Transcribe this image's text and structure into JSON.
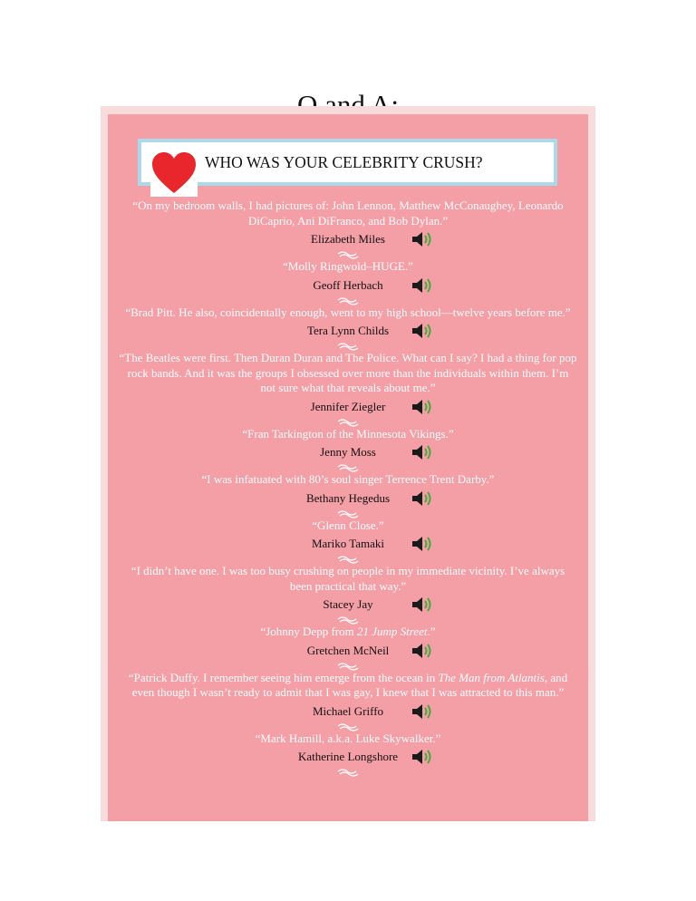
{
  "page_title": "Q and A:",
  "question": "WHO WAS YOUR CELEBRITY CRUSH?",
  "colors": {
    "panel": "#f49ea6",
    "frame": "#a9d9ea",
    "heart": "#e8262c",
    "speaker_green": "#3fae3a"
  },
  "icons": {
    "heart": "heart-icon",
    "speaker": "speaker-icon",
    "divider": "ornament-icon"
  },
  "entries": [
    {
      "quote": "“On my bedroom walls, I had pictures of: John Lennon, Matthew McConaughey, Leonardo DiCaprio, Ani DiFranco, and Bob Dylan.”",
      "author": "Elizabeth Miles"
    },
    {
      "quote": "“Molly Ringwold–HUGE.”",
      "author": "Geoff Herbach"
    },
    {
      "quote": "“Brad Pitt. He also, coincidentally enough, went to my high school—twelve years before me.”",
      "author": "Tera Lynn Childs"
    },
    {
      "quote": "“The Beatles were first. Then Duran Duran and The Police. What can I say? I had a thing for pop rock bands. And it was the groups I obsessed over more than the individuals within them. I’m not sure what that reveals about me.”",
      "author": "Jennifer Ziegler"
    },
    {
      "quote": "“Fran Tarkington of the Minnesota Vikings.”",
      "author": "Jenny Moss"
    },
    {
      "quote": "“I was infatuated with 80’s soul singer Terrence Trent Darby.”",
      "author": "Bethany Hegedus"
    },
    {
      "quote": "“Glenn Close.”",
      "author": "Mariko Tamaki"
    },
    {
      "quote": "“I didn’t have one. I was too busy crushing on people in my immediate vicinity. I’ve always been practical that way.”",
      "author": "Stacey Jay"
    },
    {
      "quote_pre": "“Johnny Depp from ",
      "quote_italic": "21 Jump Street",
      "quote_post": ".”",
      "author": "Gretchen McNeil"
    },
    {
      "quote_pre": "“Patrick Duffy. I remember seeing him emerge from the ocean in ",
      "quote_italic": "The Man from Atlantis",
      "quote_post": ", and even though I wasn’t ready to admit that I was gay, I knew that I was attracted to this man.”",
      "author": "Michael Griffo"
    },
    {
      "quote": "“Mark Hamill, a.k.a. Luke Skywalker.”",
      "author": "Katherine Longshore"
    }
  ]
}
